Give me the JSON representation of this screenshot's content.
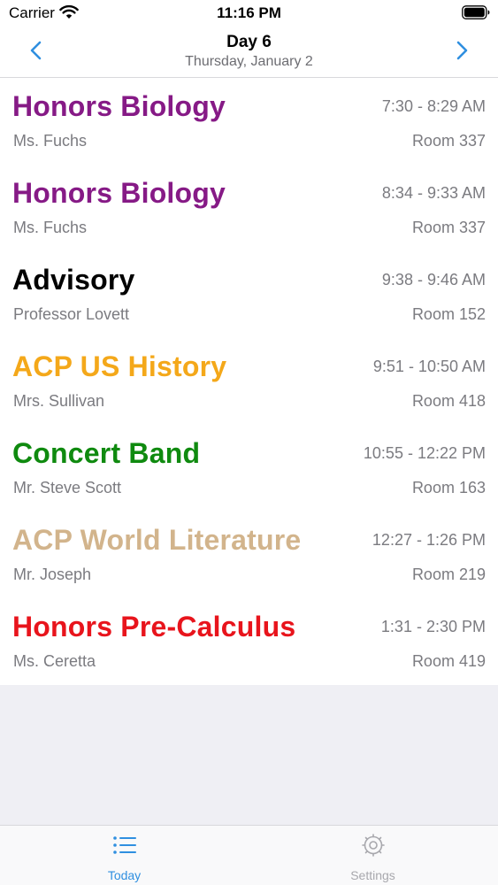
{
  "status_bar": {
    "carrier": "Carrier",
    "time": "11:16 PM"
  },
  "nav": {
    "title": "Day 6",
    "subtitle": "Thursday, January 2",
    "back_icon": "chevron-left-icon",
    "forward_icon": "chevron-right-icon",
    "accent_color": "#2f8fe0"
  },
  "periods": [
    {
      "name": "Honors Biology",
      "time": "7:30 - 8:29 AM",
      "teacher": "Ms. Fuchs",
      "room": "Room 337",
      "color": "#861a86"
    },
    {
      "name": "Honors Biology",
      "time": "8:34 - 9:33 AM",
      "teacher": "Ms. Fuchs",
      "room": "Room 337",
      "color": "#861a86"
    },
    {
      "name": "Advisory",
      "time": "9:38 - 9:46 AM",
      "teacher": "Professor Lovett",
      "room": "Room 152",
      "color": "#000000"
    },
    {
      "name": "ACP US History",
      "time": "9:51 - 10:50 AM",
      "teacher": "Mrs. Sullivan",
      "room": "Room 418",
      "color": "#f4a81a"
    },
    {
      "name": "Concert Band",
      "time": "10:55 - 12:22 PM",
      "teacher": "Mr. Steve Scott",
      "room": "Room 163",
      "color": "#0f8a0f"
    },
    {
      "name": "ACP World Literature",
      "time": "12:27 - 1:26 PM",
      "teacher": "Mr. Joseph",
      "room": "Room 219",
      "color": "#d2b48c"
    },
    {
      "name": "Honors Pre-Calculus",
      "time": "1:31 - 2:30 PM",
      "teacher": "Ms. Ceretta",
      "room": "Room 419",
      "color": "#e8141c"
    }
  ],
  "tabs": [
    {
      "label": "Today",
      "icon": "list-icon",
      "selected": true,
      "color": "#2f8fe0"
    },
    {
      "label": "Settings",
      "icon": "gear-icon",
      "selected": false,
      "color": "#a8a8ad"
    }
  ]
}
